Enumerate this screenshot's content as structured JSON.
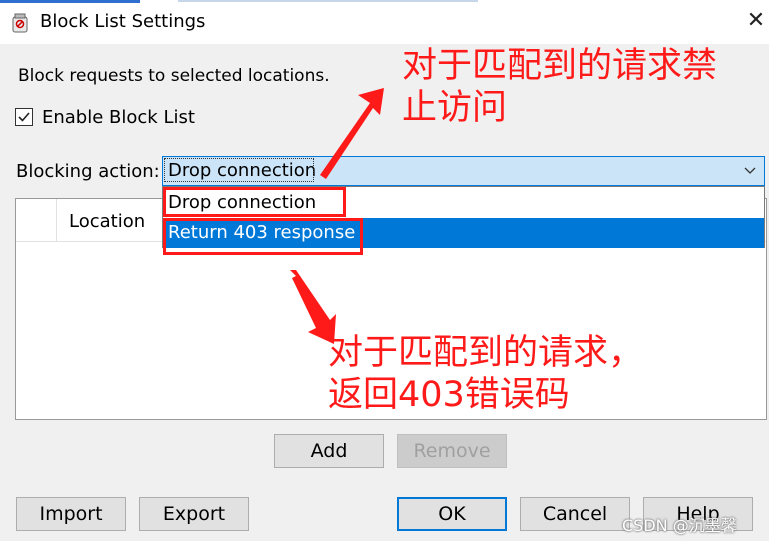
{
  "window": {
    "title": "Block List Settings",
    "close_label": "✕"
  },
  "description": "Block requests to selected locations.",
  "enable_block_list": {
    "label": "Enable Block List",
    "checked": true
  },
  "blocking_action": {
    "label": "Blocking action:",
    "selected": "Drop connection",
    "options": [
      "Drop connection",
      "Return 403 response"
    ],
    "highlighted_option": "Return 403 response"
  },
  "table": {
    "columns": [
      "",
      "Location"
    ],
    "rows": []
  },
  "buttons": {
    "add": "Add",
    "remove": "Remove",
    "import": "Import",
    "export": "Export",
    "ok": "OK",
    "cancel": "Cancel",
    "help": "Help"
  },
  "annotations": {
    "top_line1": "对于匹配到的请求禁",
    "top_line2": "止访问",
    "bottom_line1": "对于匹配到的请求，",
    "bottom_line2": "返回403错误码"
  },
  "watermark": "CSDN @沉墨馨",
  "colors": {
    "accent": "#0078d7",
    "annotation_red": "#ff1a1a",
    "combo_bg": "#cce4f7"
  }
}
